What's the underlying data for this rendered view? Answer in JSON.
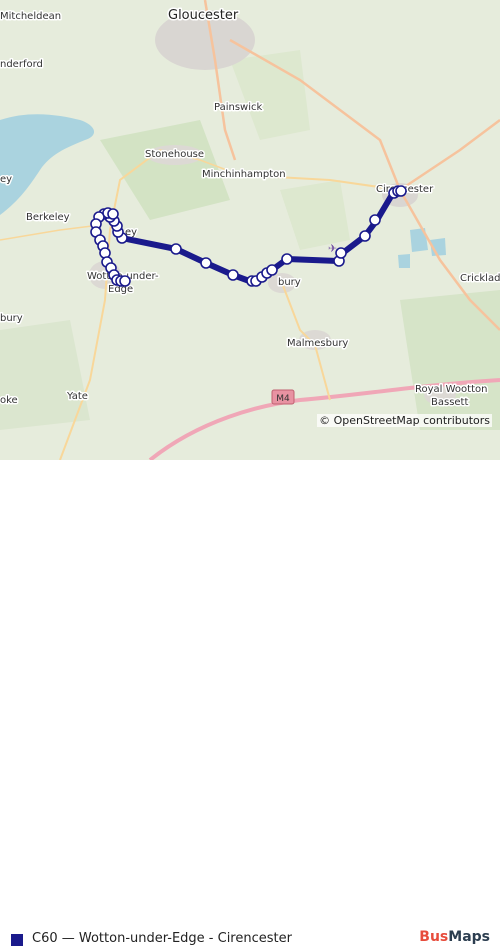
{
  "map": {
    "places": [
      {
        "name": "Mitcheldean"
      },
      {
        "name": "Gloucester"
      },
      {
        "name": "nderford"
      },
      {
        "name": "Painswick"
      },
      {
        "name": "Stonehouse"
      },
      {
        "name": "Minchinhampton"
      },
      {
        "name": "Cirencester"
      },
      {
        "name": "Berkeley"
      },
      {
        "name": "Wotton-under-"
      },
      {
        "name": "Edge"
      },
      {
        "name": "Tetbury"
      },
      {
        "name": "Malmesbury"
      },
      {
        "name": "Cricklade"
      },
      {
        "name": "Royal Wootton"
      },
      {
        "name": "Bassett"
      },
      {
        "name": "Yate"
      },
      {
        "name": "bury"
      },
      {
        "name": "oke"
      },
      {
        "name": "ey"
      },
      {
        "name": "ey"
      }
    ],
    "road_shield": "M4",
    "route_color": "#1a1a8c",
    "attribution": "© OpenStreetMap contributors"
  },
  "legend": {
    "route_text": "C60 — Wotton-under-Edge - Cirencester",
    "route_color": "#1a1a8c"
  },
  "brand": {
    "part1": "Bus",
    "part2": "Maps"
  }
}
